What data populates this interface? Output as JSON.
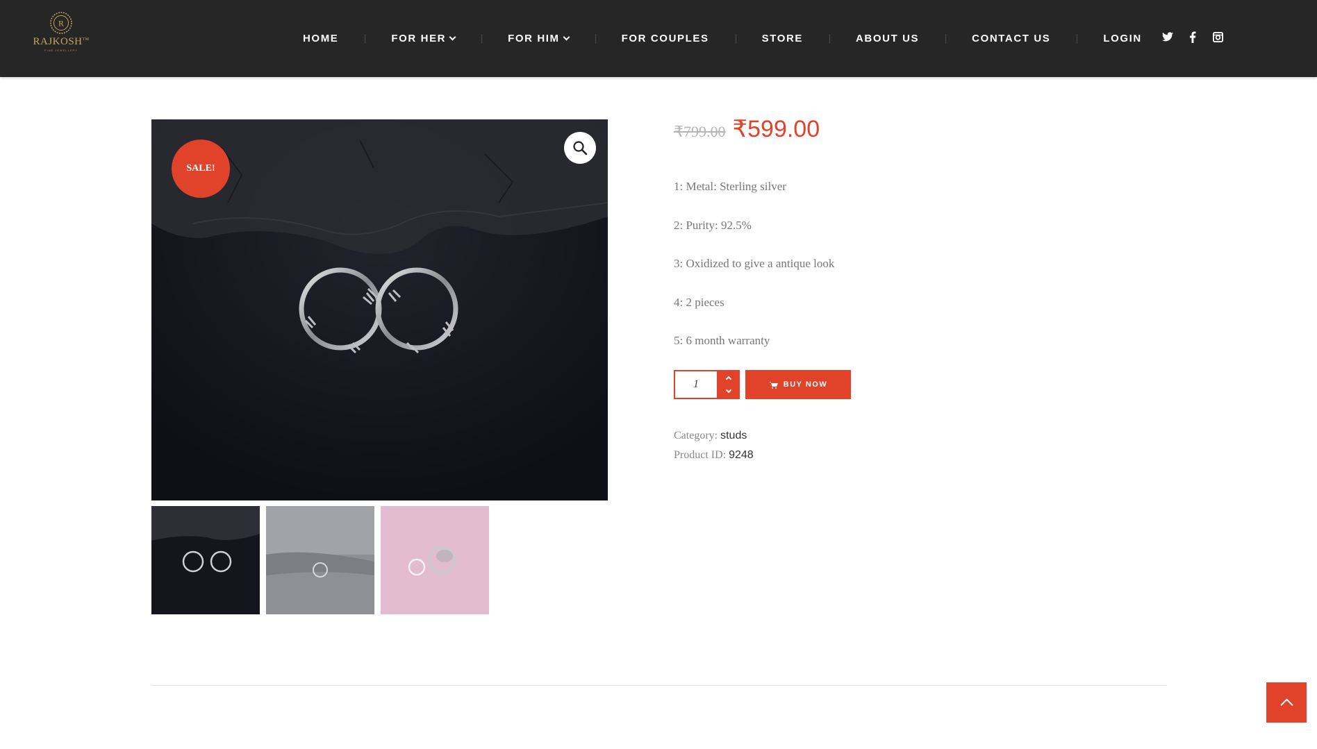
{
  "brand": {
    "name": "RAJKOSH",
    "tm": "TM",
    "tagline": "FINE JEWELLERY",
    "emblem_letter": "R",
    "gold": "#c8a35a"
  },
  "nav": {
    "items": [
      {
        "label": "HOME",
        "dropdown": false
      },
      {
        "label": "FOR HER",
        "dropdown": true
      },
      {
        "label": "FOR HIM",
        "dropdown": true
      },
      {
        "label": "FOR COUPLES",
        "dropdown": false
      },
      {
        "label": "STORE",
        "dropdown": false
      },
      {
        "label": "ABOUT US",
        "dropdown": false
      },
      {
        "label": "CONTACT US",
        "dropdown": false
      },
      {
        "label": "LOGIN",
        "dropdown": false
      }
    ]
  },
  "social": [
    "twitter-icon",
    "facebook-icon",
    "instagram-icon"
  ],
  "product": {
    "sale_badge": "SALE!",
    "old_price": "₹799.00",
    "price": "₹599.00",
    "features": [
      "1: Metal: Sterling silver",
      "2: Purity: 92.5%",
      "3: Oxidized to give a antique look",
      "4: 2 pieces",
      "5: 6 month warranty"
    ],
    "quantity": "1",
    "buy_label": "BUY NOW",
    "category_label": "Category:",
    "category_value": "studs",
    "id_label": "Product ID:",
    "id_value": "9248"
  },
  "colors": {
    "accent": "#e0432a",
    "header_bg": "#262626"
  }
}
